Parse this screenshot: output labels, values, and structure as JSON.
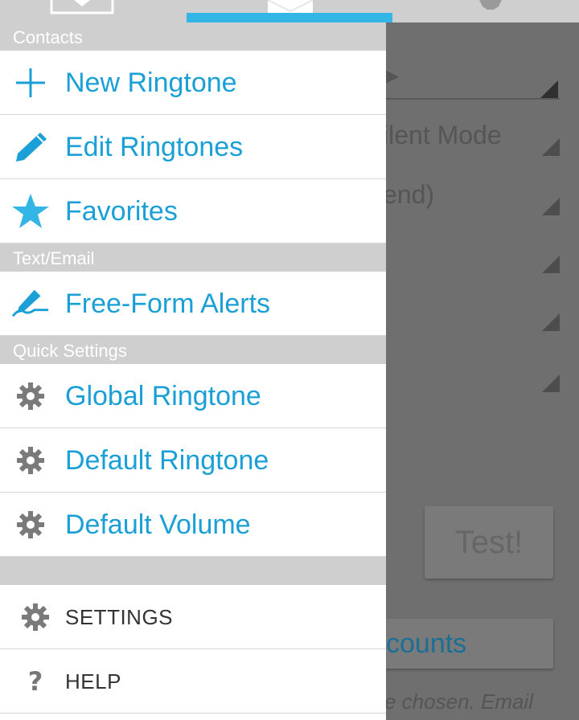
{
  "drawer": {
    "sections": [
      {
        "header": "Contacts",
        "items": [
          {
            "label": "New Ringtone",
            "icon": "plus-icon"
          },
          {
            "label": "Edit Ringtones",
            "icon": "pencil-icon"
          },
          {
            "label": "Favorites",
            "icon": "star-icon"
          }
        ]
      },
      {
        "header": "Text/Email",
        "items": [
          {
            "label": "Free-Form Alerts",
            "icon": "signature-pen-icon"
          }
        ]
      },
      {
        "header": "Quick Settings",
        "items": [
          {
            "label": "Global Ringtone",
            "icon": "gear-icon"
          },
          {
            "label": "Default Ringtone",
            "icon": "gear-icon"
          },
          {
            "label": "Default Volume",
            "icon": "gear-icon"
          }
        ]
      }
    ],
    "footer_items": [
      {
        "label": "SETTINGS",
        "icon": "gear-icon"
      },
      {
        "label": "HELP",
        "icon": "question-icon"
      }
    ]
  },
  "background": {
    "silent_mode_fragment": "ilent Mode",
    "end_fragment": "end)",
    "test_button": "Test!",
    "accounts_fragment": "counts",
    "note_fragment": "e chosen. Email"
  },
  "colors": {
    "accent": "#33b5e5",
    "link": "#1a9fd6",
    "header_bg": "#cfcfcf"
  }
}
